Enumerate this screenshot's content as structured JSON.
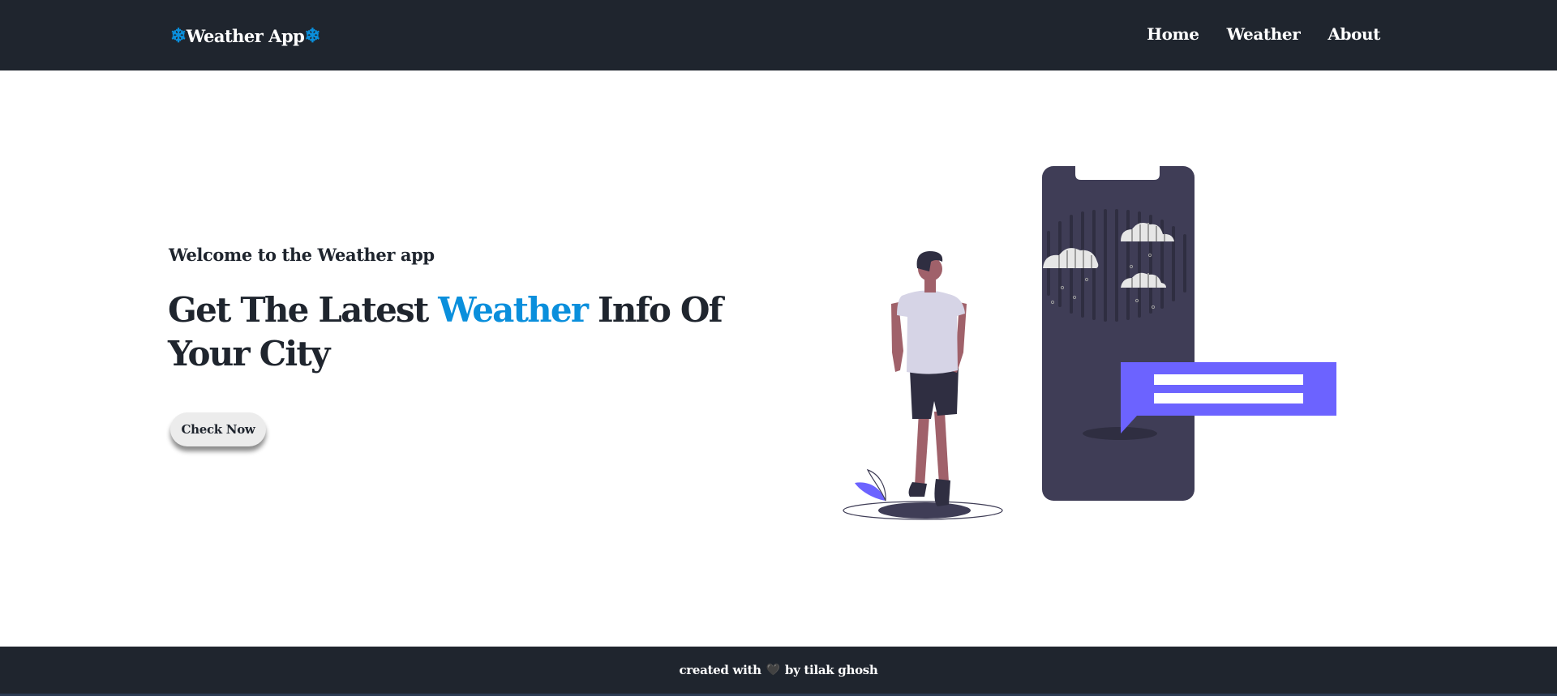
{
  "navbar": {
    "brand_icon_left": "❄",
    "brand_label": "Weather App",
    "brand_icon_right": "❄",
    "links": [
      "Home",
      "Weather",
      "About"
    ]
  },
  "hero": {
    "welcome": "Welcome to the Weather app",
    "headline_part1": "Get The Latest ",
    "headline_accent": "Weather",
    "headline_part2": " Info Of Your City",
    "cta_label": "Check Now"
  },
  "footer": {
    "text_before": "created with",
    "heart": "🖤",
    "text_after": "by tilak ghosh"
  },
  "colors": {
    "nav_bg": "#1f252e",
    "accent_blue": "#0a8fdc",
    "illustration_purple": "#6c63ff",
    "phone_dark": "#3f3d56"
  }
}
